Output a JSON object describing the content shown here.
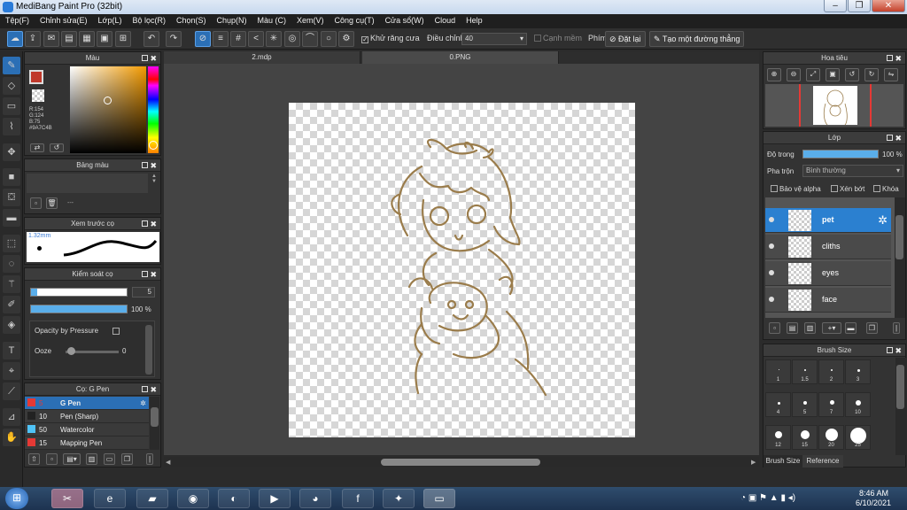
{
  "window": {
    "title": "MediBang Paint Pro (32bit)"
  },
  "menu": [
    "Tệp(F)",
    "Chỉnh sửa(E)",
    "Lớp(L)",
    "Bộ lọc(R)",
    "Chọn(S)",
    "Chụp(N)",
    "Màu (C)",
    "Xem(V)",
    "Công cụ(T)",
    "Cửa sổ(W)",
    "Cloud",
    "Help"
  ],
  "toolbar": {
    "antialias_label": "Khử răng cưa",
    "adjust_label": "Điều chỉnh",
    "adjust_value": "40",
    "edge_label": "Cạnh mềm",
    "key_label": "Phím",
    "reset_label": "Đặt lại",
    "straight_line_label": "Tạo một đường thẳng"
  },
  "color_panel": {
    "title": "Màu",
    "r": "R:154",
    "g": "G:124",
    "b": "B:75",
    "hex": "#9A7C4B",
    "current_color": "#9a7c4b",
    "fg_swatch": "#c0392b"
  },
  "palette_panel": {
    "title": "Bảng màu",
    "empty": "---"
  },
  "brush_preview": {
    "title": "Xem trước cọ",
    "size": "1.32mm"
  },
  "brush_control": {
    "title": "Kiểm soát cọ",
    "size_value": "5",
    "opacity_value": "100 %",
    "opacity_label": "Opacity by Pressure",
    "ooze_label": "Ooze",
    "ooze_value": "0"
  },
  "brush_list": {
    "title": "Cọ: G Pen",
    "items": [
      {
        "size": "5",
        "name": "G Pen",
        "color": "#e53935"
      },
      {
        "size": "10",
        "name": "Pen (Sharp)",
        "color": "#222222"
      },
      {
        "size": "50",
        "name": "Watercolor",
        "color": "#4fc3f7"
      },
      {
        "size": "15",
        "name": "Mapping Pen",
        "color": "#e53935"
      }
    ]
  },
  "tabs": [
    "2.mdp",
    "0.PNG"
  ],
  "navigator": {
    "title": "Hoa tiêu"
  },
  "layer_panel": {
    "title": "Lớp",
    "opacity_label": "Độ trong",
    "opacity_value": "100 %",
    "blend_label": "Pha trộn",
    "blend_value": "Bình thường",
    "protect_alpha": "Bảo vệ alpha",
    "clip": "Xén bớt",
    "lock": "Khóa",
    "layers": [
      "pet",
      "cliths",
      "eyes",
      "face"
    ]
  },
  "brush_size_panel": {
    "title": "Brush Size",
    "sizes": [
      "1",
      "1.5",
      "2",
      "3",
      "4",
      "5",
      "7",
      "10",
      "12",
      "15",
      "20",
      "25"
    ],
    "tab_brush_size": "Brush Size",
    "tab_reference": "Reference"
  },
  "taskbar": {
    "time": "8:46 AM",
    "date": "6/10/2021"
  },
  "colors": {
    "accent": "#2b6fb5",
    "line_art": "#9a7c4b"
  }
}
